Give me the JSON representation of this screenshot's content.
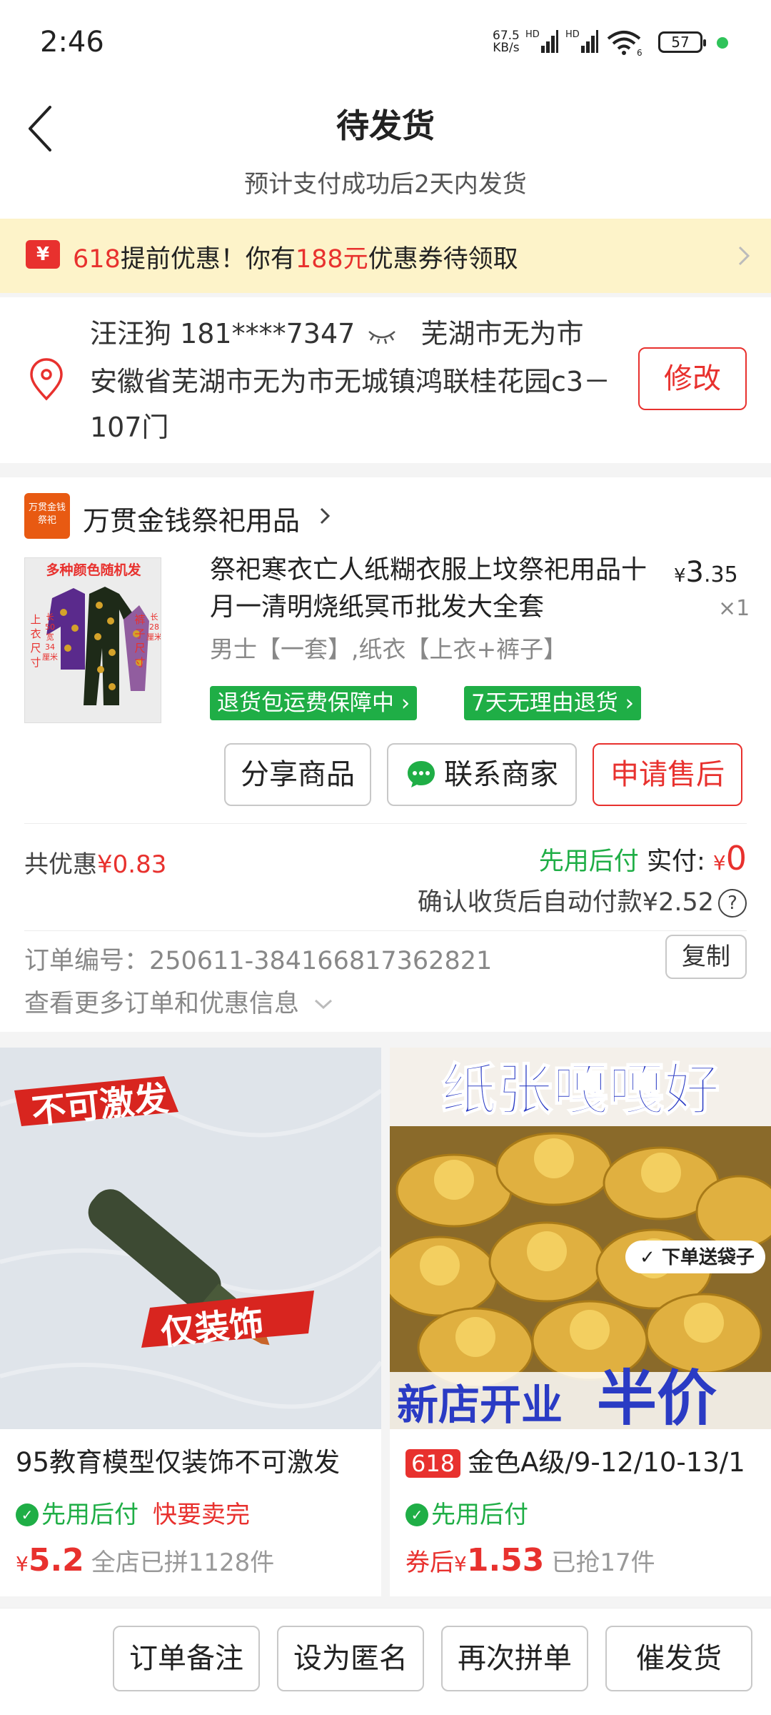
{
  "status_bar": {
    "time": "2:46",
    "net_speed_value": "67.5",
    "net_speed_unit": "KB/s",
    "battery": "57",
    "hd1": "HD",
    "hd2": "HD",
    "wifi_label": "6"
  },
  "header": {
    "title": "待发货",
    "subtitle": "预计支付成功后2天内发货"
  },
  "promo": {
    "icon_text": "¥",
    "part1": "618",
    "part2": "提前优惠！你有",
    "part3": "188元",
    "part4": "优惠券待领取"
  },
  "address": {
    "name_phone": "汪汪狗  181****7347",
    "city": "芜湖市无为市",
    "detail": "安徽省芜湖市无为市无城镇鸿联桂花园c3－107门",
    "edit_label": "修改"
  },
  "shop": {
    "logo_text": "万贯金钱祭祀",
    "name": "万贯金钱祭祀用品"
  },
  "product": {
    "thumb_banner": "多种颜色随机发",
    "thumb_left": "上衣尺寸",
    "thumb_left_detail": "长50宽34厘米",
    "thumb_right": "裤子尺寸",
    "thumb_right_detail": "长28厘米",
    "title": "祭祀寒衣亡人纸糊衣服上坟祭祀用品十月一清明烧纸冥币批发大全套",
    "price_symbol": "¥",
    "price_int": "3",
    "price_dec": ".35",
    "qty": "×1",
    "spec": "男士【一套】,纸衣【上衣+裤子】",
    "tag1": "退货包运费保障中",
    "tag2": "7天无理由退货"
  },
  "actions": {
    "share": "分享商品",
    "contact": "联系商家",
    "after_sale": "申请售后"
  },
  "summary": {
    "discount_label": "共优惠",
    "discount_value": "¥0.83",
    "pay_later": "先用后付",
    "actual_label": "实付:",
    "actual_symbol": "¥",
    "actual_value": "0",
    "auto_pay": "确认收货后自动付款¥2.52",
    "help": "?"
  },
  "order_info": {
    "order_no": "订单编号：250611-384166817362821",
    "copy_label": "复制",
    "more_label": "查看更多订单和优惠信息"
  },
  "recommend": [
    {
      "img_text1": "不可激发",
      "img_text2": "仅装饰",
      "name": "95教育模型仅装饰不可激发",
      "pay_later": "先用后付",
      "hot": "快要卖完",
      "price_symbol": "¥",
      "price": "5.2",
      "sold": "全店已拼1128件"
    },
    {
      "img_top": "纸张嘎嘎好",
      "img_badge": "下单送袋子",
      "img_bottom_left": "新店开业",
      "img_bottom_right": "半价",
      "badge": "618",
      "name": "金色A级/9-12/10-13/1",
      "pay_later": "先用后付",
      "price_prefix": "券后",
      "price_symbol": "¥",
      "price": "1.53",
      "sold": "已抢17件"
    }
  ],
  "bottom_bar": {
    "note": "订单备注",
    "anonymous": "设为匿名",
    "again": "再次拼单",
    "urge": "催发货"
  }
}
